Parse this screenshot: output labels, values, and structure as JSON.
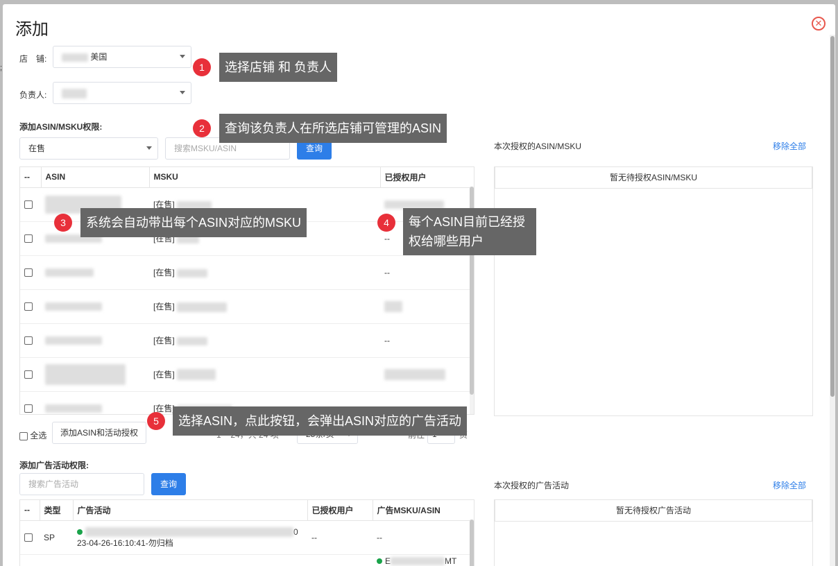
{
  "modal": {
    "title": "添加",
    "close_symbol": "✕"
  },
  "shop": {
    "label": "店　铺:",
    "value": "美国"
  },
  "owner": {
    "label": "负责人:"
  },
  "asin_section": {
    "title": "添加ASIN/MSKU权限:",
    "status_select": "在售",
    "search_placeholder": "搜索MSKU/ASIN",
    "query_button": "查询",
    "columns": [
      "--",
      "ASIN",
      "MSKU",
      "已授权用户"
    ],
    "rows": [
      {
        "msku_prefix": "[在售]",
        "users": ""
      },
      {
        "msku_prefix": "[在售]",
        "users": "--"
      },
      {
        "msku_prefix": "[在售]",
        "users": "--"
      },
      {
        "msku_prefix": "[在售]",
        "users": ""
      },
      {
        "msku_prefix": "[在售]",
        "users": "--"
      },
      {
        "msku_prefix": "[在售]",
        "users": ""
      },
      {
        "msku_prefix": "[在售]",
        "users": "--"
      }
    ],
    "select_all": "全选",
    "add_button": "添加ASIN和活动授权",
    "pager_text": "1 ~ 24，共 24 项",
    "page_size": "25条/页",
    "prev": "<",
    "next": ">",
    "goto_label": "前往",
    "goto_value": "1",
    "page_unit": "页"
  },
  "asin_right": {
    "title": "本次授权的ASIN/MSKU",
    "remove_all": "移除全部",
    "empty": "暂无待授权ASIN/MSKU"
  },
  "ad_section": {
    "title": "添加广告活动权限:",
    "search_placeholder": "搜索广告活动",
    "query_button": "查询",
    "columns": [
      "--",
      "类型",
      "广告活动",
      "已授权用户",
      "广告MSKU/ASIN"
    ],
    "rows": [
      {
        "type": "SP",
        "name_tail": "0",
        "date": "23-04-26-16:10:41-勿归档",
        "users": "--",
        "msku": "--"
      }
    ],
    "partial_row": {
      "msku_start": "E",
      "msku_end": "MT"
    }
  },
  "ad_right": {
    "title": "本次授权的广告活动",
    "remove_all": "移除全部",
    "empty": "暂无待授权广告活动"
  },
  "callouts": [
    {
      "num": "1",
      "text": "选择店铺 和 负责人"
    },
    {
      "num": "2",
      "text": "查询该负责人在所选店铺可管理的ASIN"
    },
    {
      "num": "3",
      "text": "系统会自动带出每个ASIN对应的MSKU"
    },
    {
      "num": "4",
      "text": "每个ASIN目前已经授权给哪些用户"
    },
    {
      "num": "5",
      "text": "选择ASIN，点此按钮，会弹出ASIN对应的广告活动"
    }
  ]
}
